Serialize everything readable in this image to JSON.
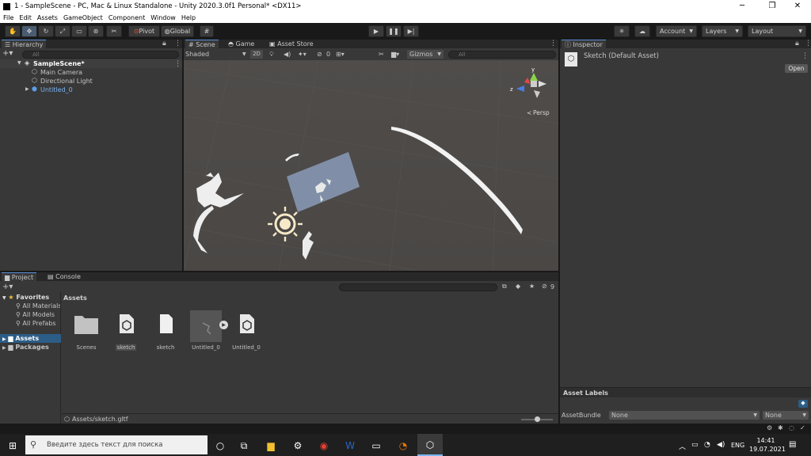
{
  "window": {
    "title": "1 - SampleScene - PC, Mac & Linux Standalone - Unity 2020.3.0f1 Personal* <DX11>",
    "minimize": "─",
    "maximize": "❐",
    "close": "✕"
  },
  "menu": [
    "File",
    "Edit",
    "Assets",
    "GameObject",
    "Component",
    "Window",
    "Help"
  ],
  "toolbar": {
    "pivot": "Pivot",
    "global": "Global",
    "account": "Account",
    "layers": "Layers",
    "layout": "Layout"
  },
  "hierarchy": {
    "tab": "Hierarchy",
    "search_placeholder": "All",
    "scene": "SampleScene*",
    "items": [
      "Main Camera",
      "Directional Light",
      "Untitled_0"
    ]
  },
  "scene_view": {
    "tabs": [
      "Scene",
      "Game",
      "Asset Store"
    ],
    "shading": "Shaded",
    "mode_2d": "2D",
    "fx_count": "0",
    "gizmos": "Gizmos",
    "search_placeholder": "All",
    "persp": "Persp",
    "axis_y": "y",
    "axis_z": "z"
  },
  "inspector": {
    "tab": "Inspector",
    "asset_title": "Sketch (Default Asset)",
    "open_button": "Open",
    "asset_labels": "Asset Labels",
    "assetbundle_label": "AssetBundle",
    "assetbundle_value": "None",
    "variant_value": "None"
  },
  "project": {
    "tabs": [
      "Project",
      "Console"
    ],
    "hidden_count": "9",
    "favorites": "Favorites",
    "favorite_items": [
      "All Materials",
      "All Models",
      "All Prefabs"
    ],
    "tree": [
      "Assets",
      "Packages"
    ],
    "breadcrumb": "Assets",
    "assets": [
      "Scenes",
      "sketch",
      "sketch",
      "Untitled_0",
      "Untitled_0"
    ],
    "status_path": "Assets/sketch.gltf"
  },
  "taskbar": {
    "search_placeholder": "Введите здесь текст для поиска",
    "lang": "ENG",
    "time": "14:41",
    "date": "19.07.2021"
  },
  "colors": {
    "accent_blue": "#5a8fd8",
    "scene_bg": "#474747",
    "selected_row": "#2c5d87"
  }
}
